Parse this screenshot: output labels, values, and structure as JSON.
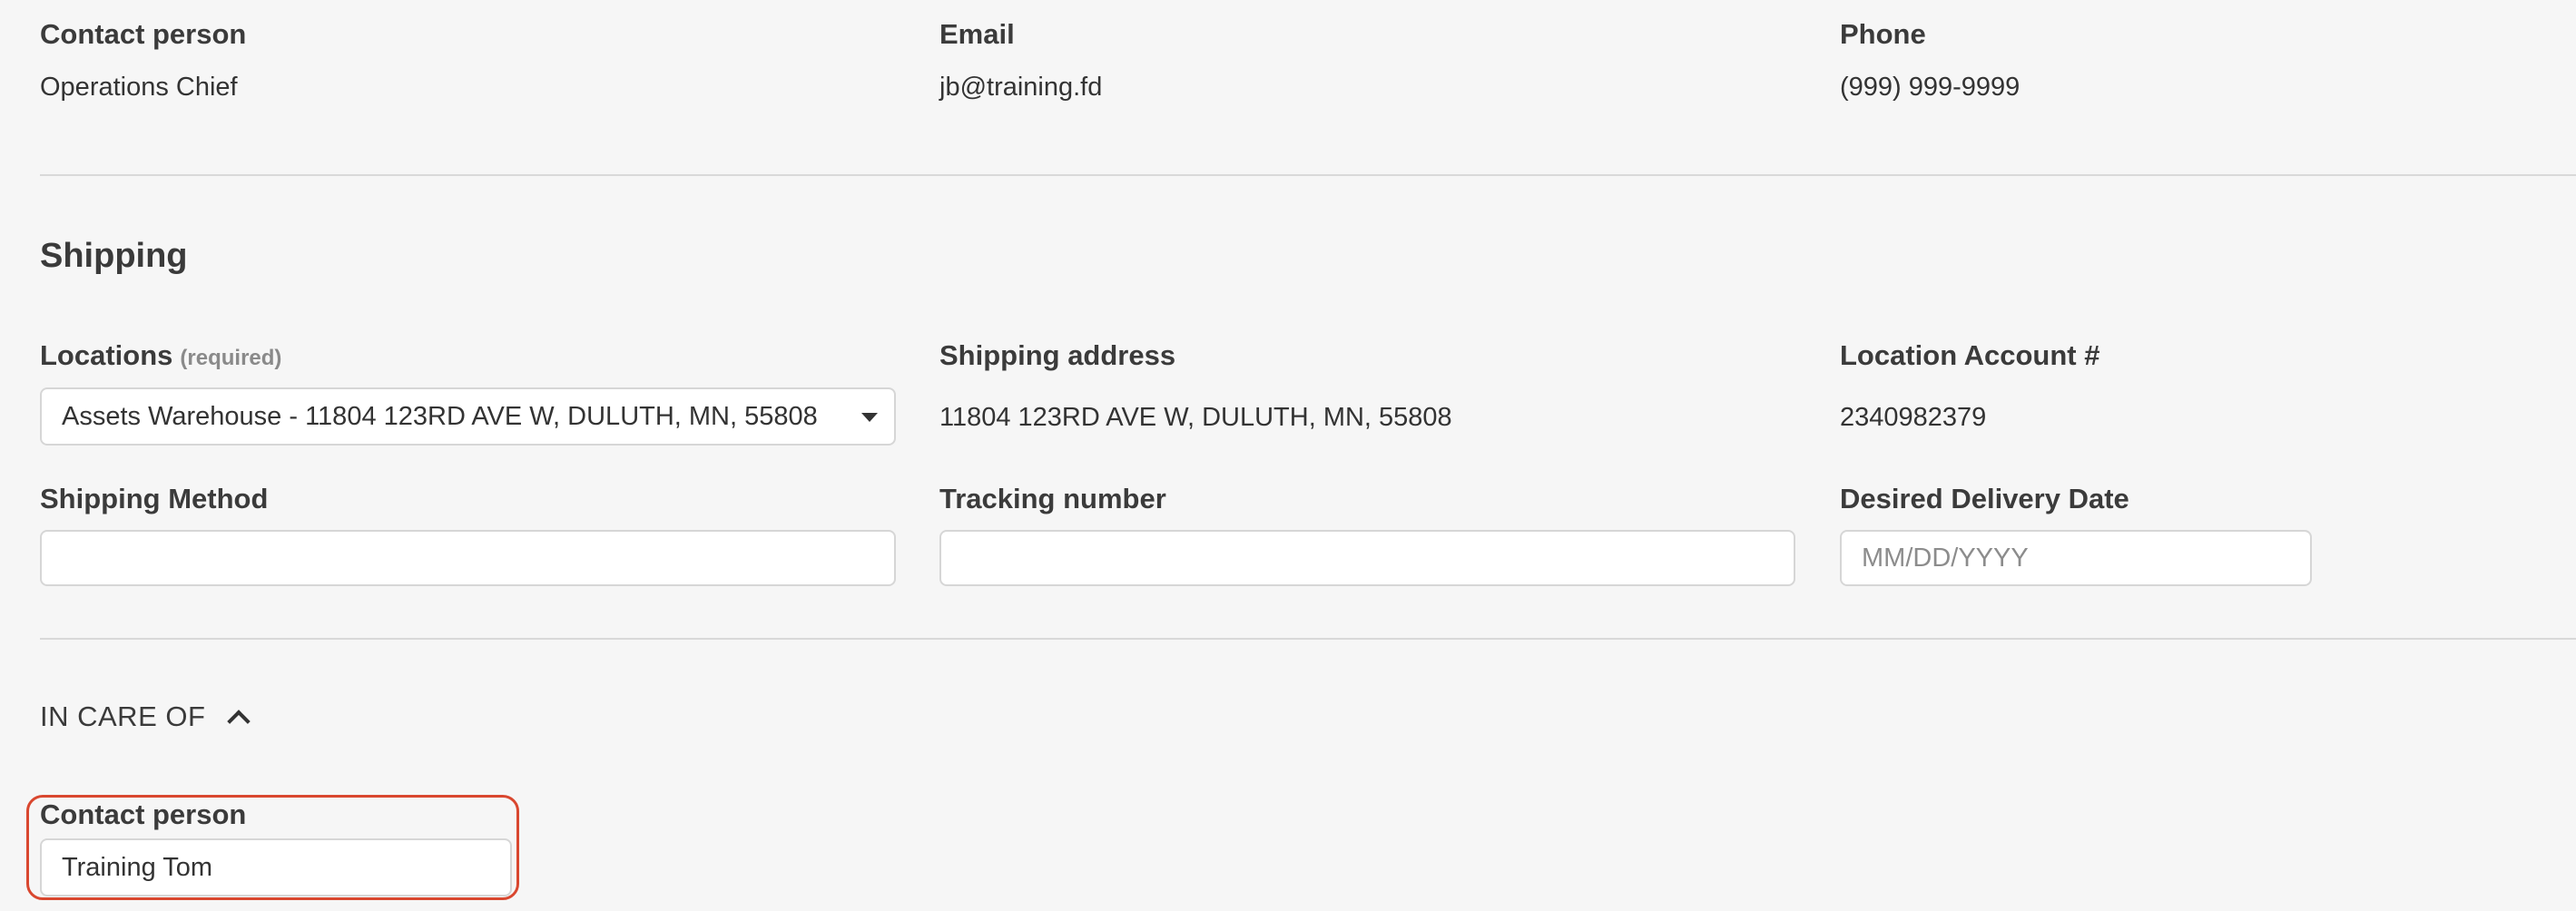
{
  "contact": {
    "person_label": "Contact person",
    "person_value": "Operations Chief",
    "email_label": "Email",
    "email_value": "jb@training.fd",
    "phone_label": "Phone",
    "phone_value": "(999) 999-9999"
  },
  "shipping": {
    "title": "Shipping",
    "locations_label": "Locations",
    "locations_required": "(required)",
    "locations_selected": "Assets Warehouse - 11804 123RD AVE W, DULUTH, MN, 55808",
    "shipping_address_label": "Shipping address",
    "shipping_address_value": "11804 123RD AVE W, DULUTH, MN, 55808",
    "location_account_label": "Location Account #",
    "location_account_value": "2340982379",
    "shipping_method_label": "Shipping Method",
    "shipping_method_value": "",
    "tracking_label": "Tracking number",
    "tracking_value": "",
    "delivery_date_label": "Desired Delivery Date",
    "delivery_date_placeholder": "MM/DD/YYYY"
  },
  "in_care_of": {
    "toggle_label": "IN CARE OF",
    "contact_label": "Contact person",
    "contact_value": "Training Tom"
  },
  "icons": {
    "dropdown": "caret-down-icon",
    "collapse": "chevron-up-icon"
  },
  "colors": {
    "background": "#f6f6f6",
    "highlight": "#d9472f",
    "divider": "#d9d9d9"
  }
}
